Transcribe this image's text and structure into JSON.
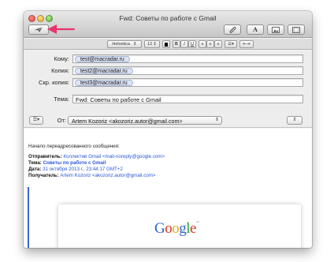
{
  "window": {
    "title": "Fwd: Советы по работе с Gmail"
  },
  "toolbar": {
    "send_icon": "paper-plane-icon",
    "attach_icon": "paperclip-icon",
    "font_label": "A",
    "photo_icon": "photo-browser-icon",
    "template_icon": "stationery-icon"
  },
  "format_bar": {
    "font_name": "Helvetica",
    "font_size": "12",
    "bold": "B",
    "italic": "I",
    "underline": "U"
  },
  "fields": {
    "to_label": "Кому:",
    "to_value": "test@macradar.ru",
    "cc_label": "Копия:",
    "cc_value": "test2@macradar.ru",
    "bcc_label": "Скр. копия:",
    "bcc_value": "test3@macradar.ru",
    "subject_label": "Тема:",
    "subject_value": "Fwd: Советы по работе с Gmail",
    "from_label": "От:",
    "from_value": "Artem Kozoriz <akozoriz.autor@gmail.com>"
  },
  "body": {
    "intro": "Начало переадресованного сообщения:",
    "sender_label": "Отправитель:",
    "sender_value": "Коллектив Gmail <mail-noreply@google.com>",
    "subject_label": "Тема:",
    "subject_value": "Советы по работе с Gmail",
    "date_label": "Дата:",
    "date_value": "31 октября 2013 г., 23:44:17 GMT+2",
    "recipient_label": "Получатель:",
    "recipient_value": "Artem Kozoriz <akozoriz.autor@gmail.com>",
    "logo_text": "Google",
    "logo_tm": "TM"
  },
  "colors": {
    "link_blue": "#2b58d8",
    "annotation_arrow": "#e8336d",
    "token_bg": "#dde4f5"
  }
}
